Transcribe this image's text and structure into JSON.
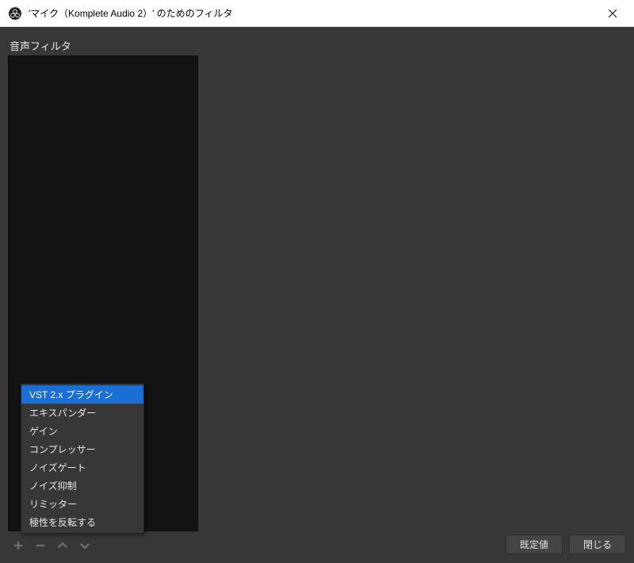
{
  "titlebar": {
    "title": "'マイク（Komplete Audio 2）' のためのフィルタ"
  },
  "section": {
    "audio_filters_label": "音声フィルタ"
  },
  "context_menu": {
    "items": [
      {
        "label": "VST 2.x プラグイン",
        "highlighted": true
      },
      {
        "label": "エキスパンダー",
        "highlighted": false
      },
      {
        "label": "ゲイン",
        "highlighted": false
      },
      {
        "label": "コンプレッサー",
        "highlighted": false
      },
      {
        "label": "ノイズゲート",
        "highlighted": false
      },
      {
        "label": "ノイズ抑制",
        "highlighted": false
      },
      {
        "label": "リミッター",
        "highlighted": false
      },
      {
        "label": "極性を反転する",
        "highlighted": false
      }
    ]
  },
  "buttons": {
    "defaults": "既定値",
    "close": "閉じる"
  }
}
